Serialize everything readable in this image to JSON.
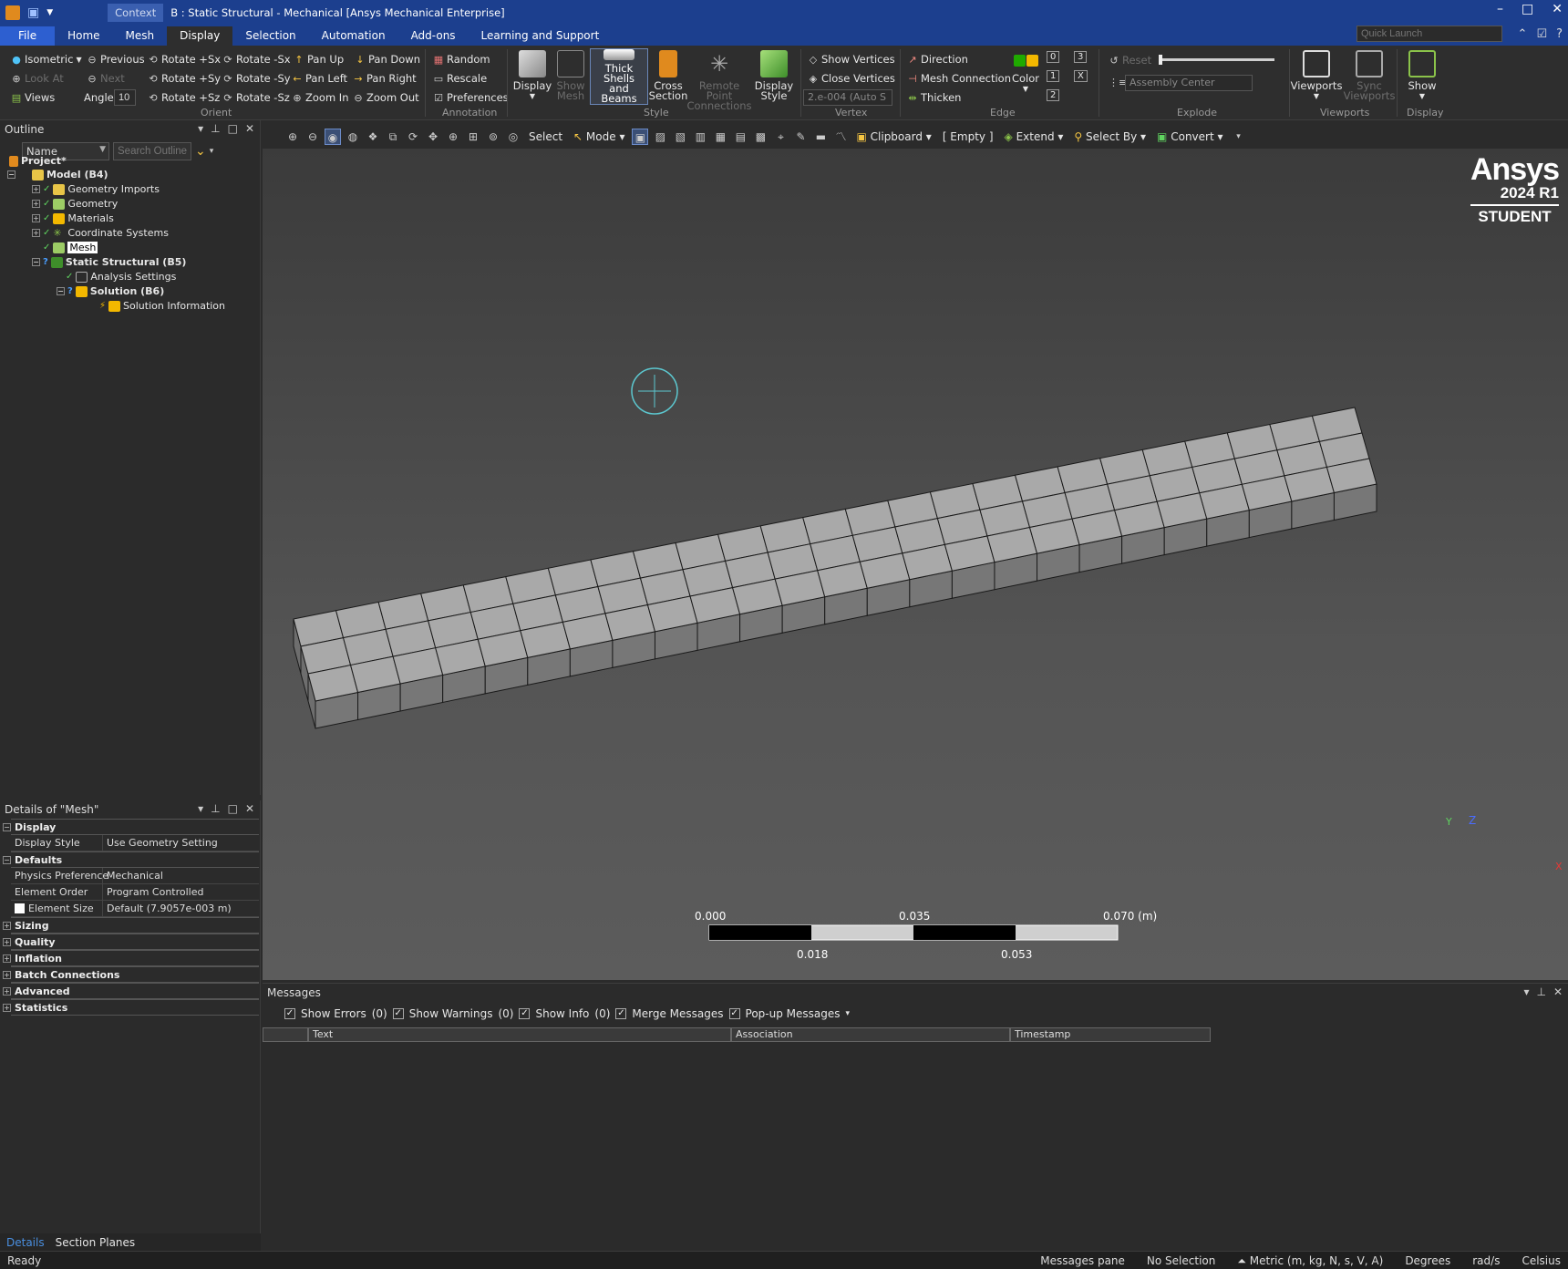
{
  "titlebar": {
    "context_label": "Context",
    "window_title": "B : Static Structural - Mechanical [Ansys Mechanical Enterprise]"
  },
  "tabs": [
    "File",
    "Home",
    "Mesh",
    "Display",
    "Selection",
    "Automation",
    "Add-ons",
    "Learning and Support"
  ],
  "active_tab": "Display",
  "quick_launch_placeholder": "Quick Launch",
  "ribbon": {
    "orient": {
      "group": "Orient",
      "isometric": "Isometric",
      "previous": "Previous",
      "look_at": "Look At",
      "next": "Next",
      "views": "Views",
      "angle_label": "Angle",
      "angle_value": "10",
      "rot_px": "Rotate +Sx",
      "rot_mx": "Rotate -Sx",
      "rot_py": "Rotate +Sy",
      "rot_my": "Rotate -Sy",
      "rot_pz": "Rotate +Sz",
      "rot_mz": "Rotate -Sz",
      "pan_up": "Pan Up",
      "pan_down": "Pan Down",
      "pan_left": "Pan Left",
      "pan_right": "Pan Right",
      "zoom_in": "Zoom In",
      "zoom_out": "Zoom Out"
    },
    "annotation": {
      "group": "Annotation",
      "random": "Random",
      "rescale": "Rescale",
      "preferences": "Preferences"
    },
    "style": {
      "group": "Style",
      "display": "Display",
      "show_mesh_1": "Show",
      "show_mesh_2": "Mesh",
      "thick_1": "Thick Shells",
      "thick_2": "and Beams",
      "cross_1": "Cross",
      "cross_2": "Section",
      "remote_1": "Remote Point",
      "remote_2": "Connections",
      "dstyle_1": "Display",
      "dstyle_2": "Style"
    },
    "vertex": {
      "group": "Vertex",
      "show_vertices": "Show Vertices",
      "close_vertices": "Close Vertices",
      "tolerance": "2.e-004 (Auto S"
    },
    "edge": {
      "group": "Edge",
      "direction": "Direction",
      "mesh_connection": "Mesh Connection",
      "thicken": "Thicken",
      "color": "Color",
      "n0": "0",
      "n1": "1",
      "n2": "2",
      "n3": "3",
      "nx": "X"
    },
    "explode": {
      "group": "Explode",
      "reset": "Reset",
      "assembly_center": "Assembly Center"
    },
    "viewports": {
      "group": "Viewports",
      "viewports": "Viewports",
      "sync_1": "Sync",
      "sync_2": "Viewports"
    },
    "display_grp": {
      "group": "Display",
      "show": "Show"
    }
  },
  "outline": {
    "header": "Outline",
    "filter_field": "Name",
    "search_placeholder": "Search Outline",
    "nodes": {
      "project": "Project*",
      "model": "Model (B4)",
      "geometry_imports": "Geometry Imports",
      "geometry": "Geometry",
      "materials": "Materials",
      "coordinate_systems": "Coordinate Systems",
      "mesh": "Mesh",
      "static_structural": "Static Structural (B5)",
      "analysis_settings": "Analysis Settings",
      "solution": "Solution (B6)",
      "solution_information": "Solution Information"
    }
  },
  "details": {
    "header": "Details of \"Mesh\"",
    "cat_display": "Display",
    "display_style_k": "Display Style",
    "display_style_v": "Use Geometry Setting",
    "cat_defaults": "Defaults",
    "physics_k": "Physics Preference",
    "physics_v": "Mechanical",
    "order_k": "Element Order",
    "order_v": "Program Controlled",
    "size_k": "Element Size",
    "size_v": "Default (7.9057e-003 m)",
    "cat_sizing": "Sizing",
    "cat_quality": "Quality",
    "cat_inflation": "Inflation",
    "cat_batch": "Batch Connections",
    "cat_advanced": "Advanced",
    "cat_statistics": "Statistics"
  },
  "panel_tabs": {
    "details": "Details",
    "section_planes": "Section Planes"
  },
  "graphics_toolbar": {
    "select": "Select",
    "mode": "Mode",
    "clipboard": "Clipboard",
    "empty": "[ Empty ]",
    "extend": "Extend",
    "select_by": "Select By",
    "convert": "Convert"
  },
  "logo": {
    "brand": "Ansys",
    "version": "2024 R1",
    "edition": "STUDENT"
  },
  "scale_bar": {
    "v0": "0.000",
    "v1": "0.035",
    "v2": "0.070 (m)",
    "v3": "0.018",
    "v4": "0.053"
  },
  "triad": {
    "y": "Y",
    "z": "Z",
    "x": "X"
  },
  "mesh_model": {
    "elements_along_length": 25,
    "elements_across_width": 3
  },
  "messages": {
    "header": "Messages",
    "show_errors": "Show Errors",
    "errors_count": "(0)",
    "show_warnings": "Show Warnings",
    "warnings_count": "(0)",
    "show_info": "Show Info",
    "info_count": "(0)",
    "merge": "Merge Messages",
    "popup": "Pop-up Messages",
    "col_text": "Text",
    "col_association": "Association",
    "col_timestamp": "Timestamp"
  },
  "status": {
    "ready": "Ready",
    "messages_pane": "Messages pane",
    "selection": "No Selection",
    "units": "Metric (m, kg, N, s, V, A)",
    "angle": "Degrees",
    "rot": "rad/s",
    "temp": "Celsius"
  },
  "colors": {
    "title_blue": "#1c3f8e",
    "file_tab": "#2d5fd0",
    "mesh_face": "#a9a9a9",
    "logo": "#ffffff"
  }
}
